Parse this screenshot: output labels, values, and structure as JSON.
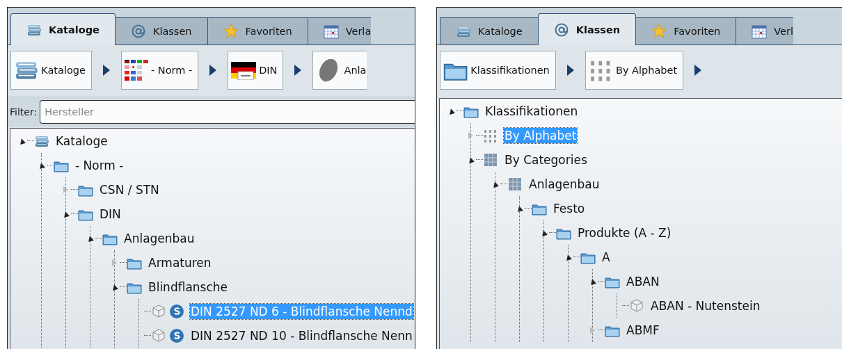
{
  "panels": [
    {
      "tabs": [
        {
          "label": "Kataloge",
          "kind": "books",
          "selected": true
        },
        {
          "label": "Klassen",
          "kind": "at",
          "selected": false
        },
        {
          "label": "Favoriten",
          "kind": "star",
          "selected": false
        },
        {
          "label": "Verla",
          "kind": "calendar",
          "selected": false
        }
      ],
      "breadcrumbs": [
        {
          "label": "Kataloge",
          "kind": "books"
        },
        {
          "label": "- Norm -",
          "kind": "flags"
        },
        {
          "label": "DIN",
          "kind": "din"
        },
        {
          "label": "Anla",
          "kind": "disc"
        }
      ],
      "filter": {
        "label": "Filter:",
        "placeholder": "Hersteller"
      },
      "tree": [
        {
          "label": "Kataloge",
          "kind": "books",
          "expanded": true,
          "selected": false,
          "children": [
            {
              "label": "- Norm -",
              "kind": "folder",
              "expanded": true,
              "selected": false,
              "children": [
                {
                  "label": "CSN / STN",
                  "kind": "folder",
                  "expanded": false,
                  "selected": false
                },
                {
                  "label": "DIN",
                  "kind": "folder",
                  "expanded": true,
                  "selected": false,
                  "children": [
                    {
                      "label": "Anlagenbau",
                      "kind": "folder",
                      "expanded": true,
                      "selected": false,
                      "children": [
                        {
                          "label": "Armaturen",
                          "kind": "folder",
                          "expanded": false,
                          "selected": false
                        },
                        {
                          "label": "Blindflansche",
                          "kind": "folder",
                          "expanded": true,
                          "selected": false,
                          "children": [
                            {
                              "label": "DIN 2527 ND 6 - Blindflansche Nennd",
                              "kind": "part",
                              "selected": true
                            },
                            {
                              "label": "DIN 2527 ND 10 - Blindflansche Nenn",
                              "kind": "part",
                              "selected": false
                            }
                          ]
                        }
                      ]
                    }
                  ]
                }
              ]
            }
          ]
        }
      ]
    },
    {
      "tabs": [
        {
          "label": "Kataloge",
          "kind": "books",
          "selected": false
        },
        {
          "label": "Klassen",
          "kind": "at",
          "selected": true
        },
        {
          "label": "Favoriten",
          "kind": "star",
          "selected": false
        },
        {
          "label": "Verl",
          "kind": "calendar",
          "selected": false
        }
      ],
      "breadcrumbs": [
        {
          "label": "Klassifikationen",
          "kind": "folder"
        },
        {
          "label": "By Alphabet",
          "kind": "abc"
        }
      ],
      "tree": [
        {
          "label": "Klassifikationen",
          "kind": "folder",
          "expanded": true,
          "selected": false,
          "children": [
            {
              "label": "By Alphabet",
              "kind": "abc",
              "expanded": false,
              "selected": true
            },
            {
              "label": "By Categories",
              "kind": "grid",
              "expanded": true,
              "selected": false,
              "children": [
                {
                  "label": "Anlagenbau",
                  "kind": "grid",
                  "expanded": true,
                  "selected": false,
                  "children": [
                    {
                      "label": "Festo",
                      "kind": "folder",
                      "expanded": true,
                      "selected": false,
                      "children": [
                        {
                          "label": "Produkte (A - Z)",
                          "kind": "folder",
                          "expanded": true,
                          "selected": false,
                          "children": [
                            {
                              "label": "A",
                              "kind": "folder",
                              "expanded": true,
                              "selected": false,
                              "children": [
                                {
                                  "label": "ABAN",
                                  "kind": "folder",
                                  "expanded": true,
                                  "selected": false,
                                  "children": [
                                    {
                                      "label": "ABAN - Nutenstein",
                                      "kind": "cube",
                                      "selected": false
                                    }
                                  ]
                                },
                                {
                                  "label": "ABMF",
                                  "kind": "folder",
                                  "expanded": false,
                                  "selected": false
                                }
                              ]
                            }
                          ]
                        }
                      ]
                    }
                  ]
                }
              ]
            }
          ]
        }
      ]
    }
  ]
}
